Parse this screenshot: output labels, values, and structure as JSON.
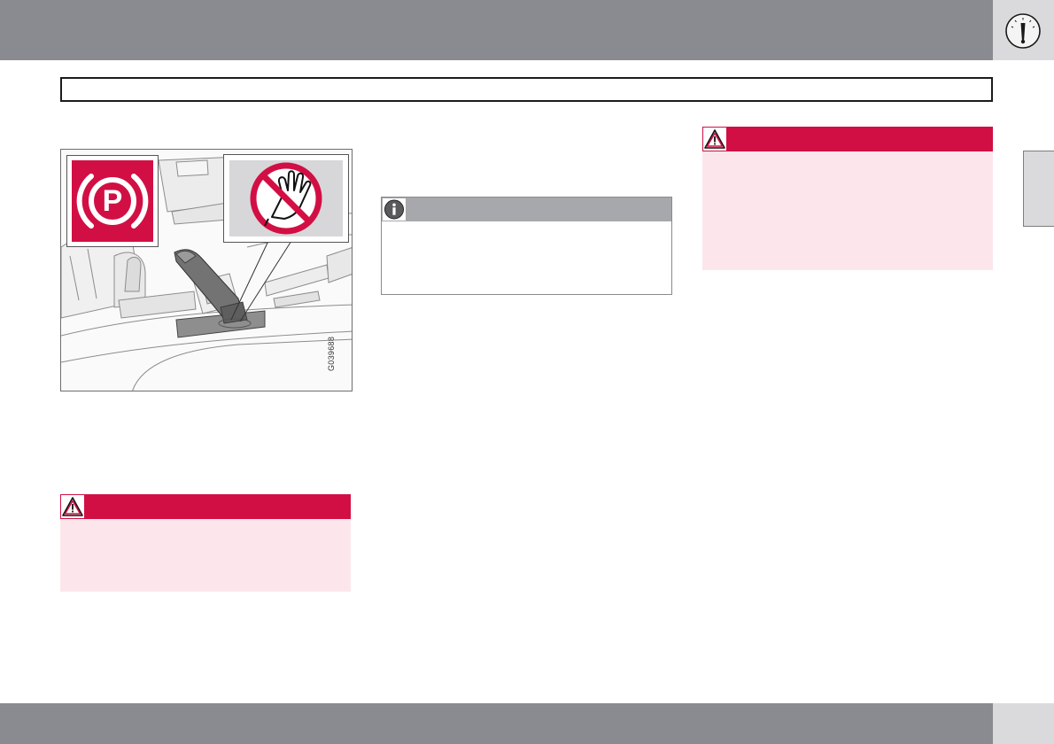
{
  "header": {
    "chapter_icon": "speedometer-gauge-icon"
  },
  "figure": {
    "code": "G039688",
    "parking_brake_symbol": "P",
    "icons": [
      "parking-brake-symbol-icon",
      "no-hands-icon",
      "parking-brake-lever-illustration"
    ]
  },
  "callouts": {
    "warning_icon": "warning-triangle-icon",
    "info_icon": "info-circle-icon"
  },
  "colors": {
    "band": "#8a8b90",
    "warning_red": "#d20f44",
    "warning_tint": "#fce6ec",
    "info_grey": "#a7a8ab",
    "tab_grey": "#dadadc"
  }
}
